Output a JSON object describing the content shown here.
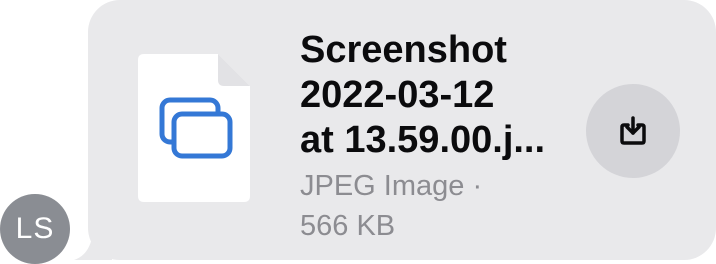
{
  "sender": {
    "initials": "LS"
  },
  "attachment": {
    "title": "Screenshot\n2022-03-12\nat 13.59.00.j...",
    "type_size": "JPEG Image ·\n566 KB",
    "icon": "overlapping-images-icon",
    "download_icon": "download-tray-icon"
  },
  "colors": {
    "bubble": "#e9e9eb",
    "avatar": "#8a8d93",
    "accent_blue": "#3478d6",
    "meta_text": "#8c8c91"
  }
}
